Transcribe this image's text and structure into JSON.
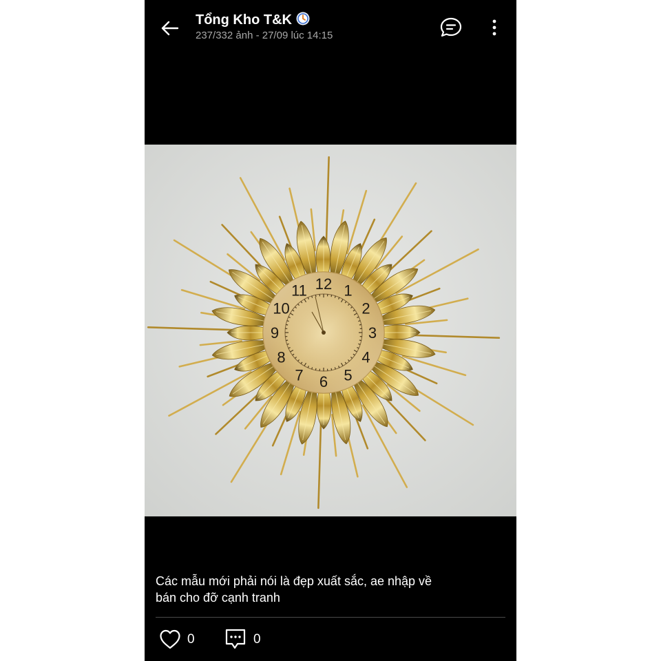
{
  "header": {
    "title": "Tổng Kho T&K",
    "subtitle": "237/332 ảnh - 27/09 lúc 14:15",
    "back_icon": "arrow-left-icon",
    "verified_icon": "verified-badge-icon",
    "comment_icon": "comment-bubble-icon",
    "more_icon": "more-vertical-icon"
  },
  "photo": {
    "subject": "gold starburst wall clock",
    "clock_numbers": [
      "12",
      "1",
      "2",
      "3",
      "4",
      "5",
      "6",
      "7",
      "8",
      "9",
      "10",
      "11"
    ]
  },
  "post": {
    "caption_line1": "Các mẫu mới phải nói là đẹp xuất sắc, ae nhập về",
    "caption_line2": "bán cho đỡ cạnh tranh"
  },
  "actions": {
    "like_icon": "heart-outline-icon",
    "like_count": "0",
    "comment_icon": "comment-outline-icon",
    "comment_count": "0"
  },
  "colors": {
    "background": "#000000",
    "text": "#ffffff",
    "subtext": "#a8a8a8",
    "wall": "#dedfdd",
    "gold": "#c9a227"
  }
}
